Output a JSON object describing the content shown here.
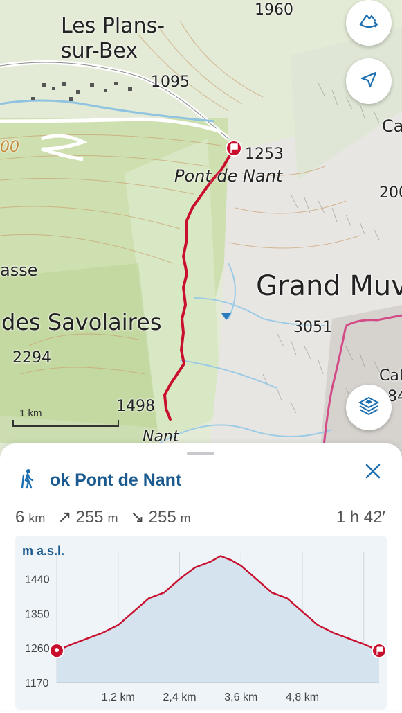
{
  "map": {
    "labels": {
      "les_plans": "Les Plans-",
      "sur_bex": "sur-Bex",
      "h1960": "1960",
      "h1095": "1095",
      "h1253": "1253",
      "pont_de_nant": "Pont de Nant",
      "grand_muveran": "Grand Muv",
      "des_savolaires": "des Savolaires",
      "h3051": "3051",
      "h2294": "2294",
      "h1498": "1498",
      "nant": "Nant",
      "asse": "asse",
      "ca": "Ca",
      "h200": "200",
      "cal": "Cal",
      "h84": "84",
      "h00": "00"
    },
    "scale_label": "1 km",
    "route_color": "#c8102e"
  },
  "buttons": {
    "rotate_icon": "3d-rotate-icon",
    "locate_icon": "location-arrow-icon",
    "layers_icon": "layers-icon"
  },
  "panel": {
    "title": "ok Pont de Nant",
    "activity_icon": "hiking-icon",
    "distance": "6",
    "distance_unit": "km",
    "ascent": "255",
    "ascent_unit": "m",
    "descent": "255",
    "descent_unit": "m",
    "duration": "1 h 42′"
  },
  "chart_data": {
    "type": "area",
    "ylabel": "m a.s.l.",
    "xlabel": "",
    "yticks": [
      "1440",
      "1350",
      "1260",
      "1170"
    ],
    "xticks": [
      "1,2 km",
      "2,4 km",
      "3,6 km",
      "4,8 km"
    ],
    "xlim": [
      0,
      6.3
    ],
    "ylim": [
      1170,
      1510
    ],
    "x": [
      0,
      0.3,
      0.6,
      0.9,
      1.2,
      1.5,
      1.8,
      2.1,
      2.4,
      2.7,
      3.0,
      3.2,
      3.4,
      3.6,
      3.9,
      4.2,
      4.5,
      4.8,
      5.1,
      5.4,
      5.7,
      6.0,
      6.3
    ],
    "values": [
      1253,
      1270,
      1285,
      1300,
      1320,
      1355,
      1390,
      1405,
      1440,
      1470,
      1485,
      1500,
      1490,
      1475,
      1440,
      1405,
      1390,
      1355,
      1320,
      1300,
      1285,
      1270,
      1253
    ],
    "fill_color": "#d4e3ee",
    "line_color": "#c8102e"
  }
}
